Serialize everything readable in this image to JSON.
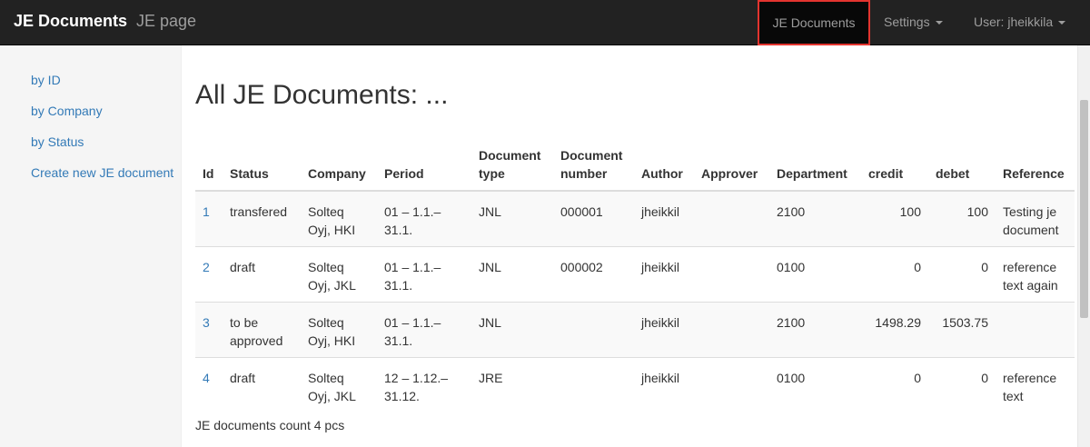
{
  "navbar": {
    "brand": "JE Documents",
    "subtitle": "JE page",
    "links": {
      "je_documents": "JE Documents",
      "settings": "Settings",
      "user": "User: jheikkila"
    }
  },
  "sidebar": {
    "items": [
      {
        "label": "by ID"
      },
      {
        "label": "by Company"
      },
      {
        "label": "by Status"
      },
      {
        "label": "Create new JE document"
      }
    ]
  },
  "main": {
    "title": "All JE Documents: ...",
    "table": {
      "headers": {
        "id": "Id",
        "status": "Status",
        "company": "Company",
        "period": "Period",
        "doc_type": "Document type",
        "doc_number": "Document number",
        "author": "Author",
        "approver": "Approver",
        "department": "Department",
        "credit": "credit",
        "debet": "debet",
        "reference": "Reference"
      },
      "rows": [
        {
          "id": "1",
          "status": "transfered",
          "company": "Solteq Oyj, HKI",
          "period": "01 – 1.1.–31.1.",
          "doc_type": "JNL",
          "doc_number": "000001",
          "author": "jheikkil",
          "approver": "",
          "department": "2100",
          "credit": "100",
          "debet": "100",
          "reference": "Testing je document"
        },
        {
          "id": "2",
          "status": "draft",
          "company": "Solteq Oyj, JKL",
          "period": "01 – 1.1.–31.1.",
          "doc_type": "JNL",
          "doc_number": "000002",
          "author": "jheikkil",
          "approver": "",
          "department": "0100",
          "credit": "0",
          "debet": "0",
          "reference": "reference text again"
        },
        {
          "id": "3",
          "status": "to be approved",
          "company": "Solteq Oyj, HKI",
          "period": "01 – 1.1.–31.1.",
          "doc_type": "JNL",
          "doc_number": "",
          "author": "jheikkil",
          "approver": "",
          "department": "2100",
          "credit": "1498.29",
          "debet": "1503.75",
          "reference": ""
        },
        {
          "id": "4",
          "status": "draft",
          "company": "Solteq Oyj, JKL",
          "period": "12 – 1.12.–31.12.",
          "doc_type": "JRE",
          "doc_number": "",
          "author": "jheikkil",
          "approver": "",
          "department": "0100",
          "credit": "0",
          "debet": "0",
          "reference": "reference text"
        }
      ]
    },
    "count_text": "JE documents count 4 pcs"
  },
  "colors": {
    "navbar_bg": "#222222",
    "link": "#337ab7",
    "highlight_border": "#e3342f"
  }
}
